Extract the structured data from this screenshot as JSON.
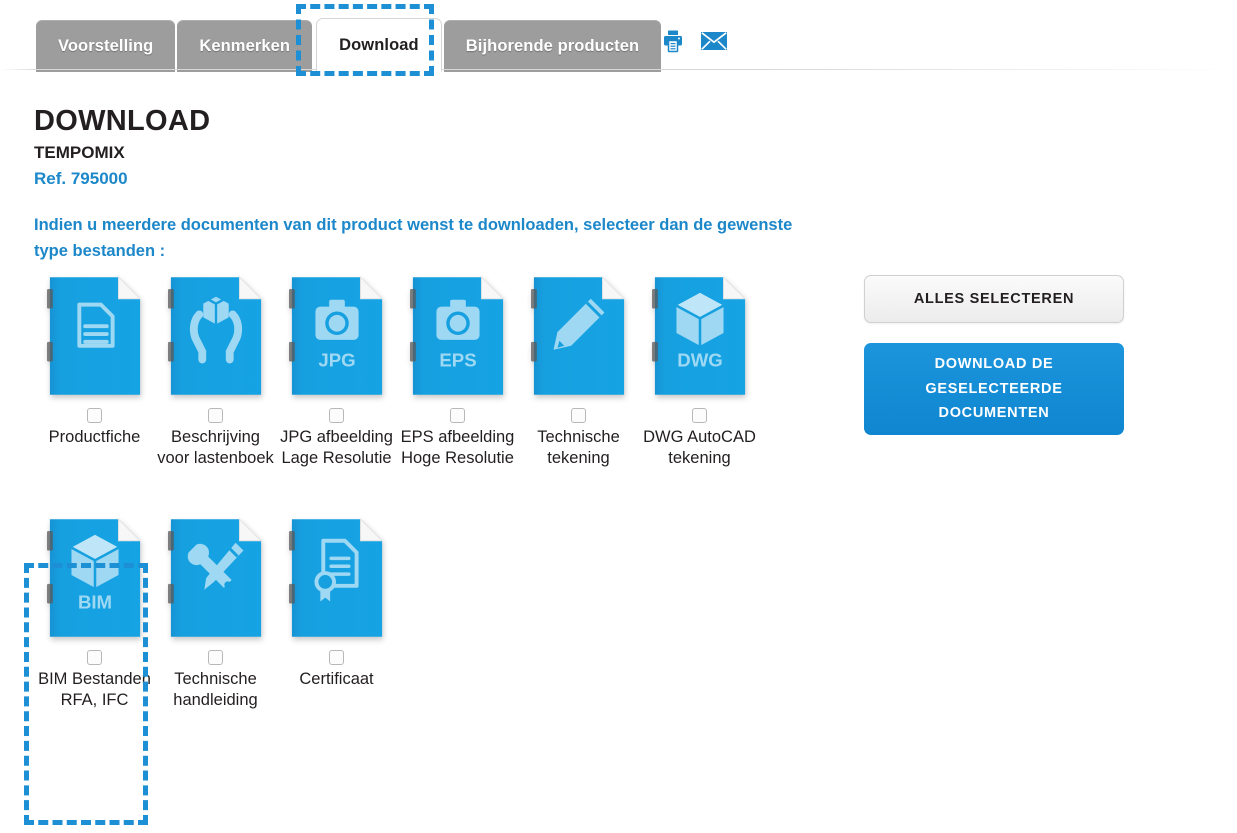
{
  "tabbar": {
    "tabs": [
      {
        "label": "Voorstelling",
        "active": false
      },
      {
        "label": "Kenmerken",
        "active": false
      },
      {
        "label": "Download",
        "active": true
      },
      {
        "label": "Bijhorende producten",
        "active": false
      }
    ],
    "tools": [
      {
        "name": "print-icon",
        "title": "Print"
      },
      {
        "name": "email-icon",
        "title": "E-mail"
      }
    ]
  },
  "page": {
    "title": "DOWNLOAD",
    "product_name": "TEMPOMIX",
    "reference": "Ref. 795000",
    "intro": "Indien u meerdere documenten van dit product wenst te downloaden, selecteer dan de gewenste type bestanden :"
  },
  "documents_row1": [
    {
      "label": "Productfiche",
      "glyph": "document",
      "badge": "",
      "checked": false
    },
    {
      "label": "Beschrijving voor lastenboek",
      "glyph": "hands-cube",
      "badge": "",
      "checked": false
    },
    {
      "label": "JPG afbeelding Lage Resolutie",
      "glyph": "camera",
      "badge": "JPG",
      "checked": false
    },
    {
      "label": "EPS afbeelding Hoge Resolutie",
      "glyph": "camera",
      "badge": "EPS",
      "checked": false
    },
    {
      "label": "Technische tekening",
      "glyph": "pencil",
      "badge": "",
      "checked": false
    },
    {
      "label": "DWG AutoCAD tekening",
      "glyph": "cube",
      "badge": "DWG",
      "checked": false
    }
  ],
  "documents_row2": [
    {
      "label": "BIM Bestanden RFA, IFC",
      "glyph": "cube",
      "badge": "BIM",
      "checked": false
    },
    {
      "label": "Technische handleiding",
      "glyph": "tools",
      "badge": "",
      "checked": false
    },
    {
      "label": "Certificaat",
      "glyph": "certificate",
      "badge": "",
      "checked": false
    }
  ],
  "actions": {
    "select_all_label": "ALLES SELECTEREN",
    "download_label": "DOWNLOAD DE GESELECTEERDE DOCUMENTEN"
  },
  "colors": {
    "accent_blue": "#1c87c9",
    "highlight_blue": "#1d8fd4",
    "doc_blue": "#17a0e0",
    "tab_gray": "#9d9d9d",
    "text_dark": "#231f20"
  }
}
